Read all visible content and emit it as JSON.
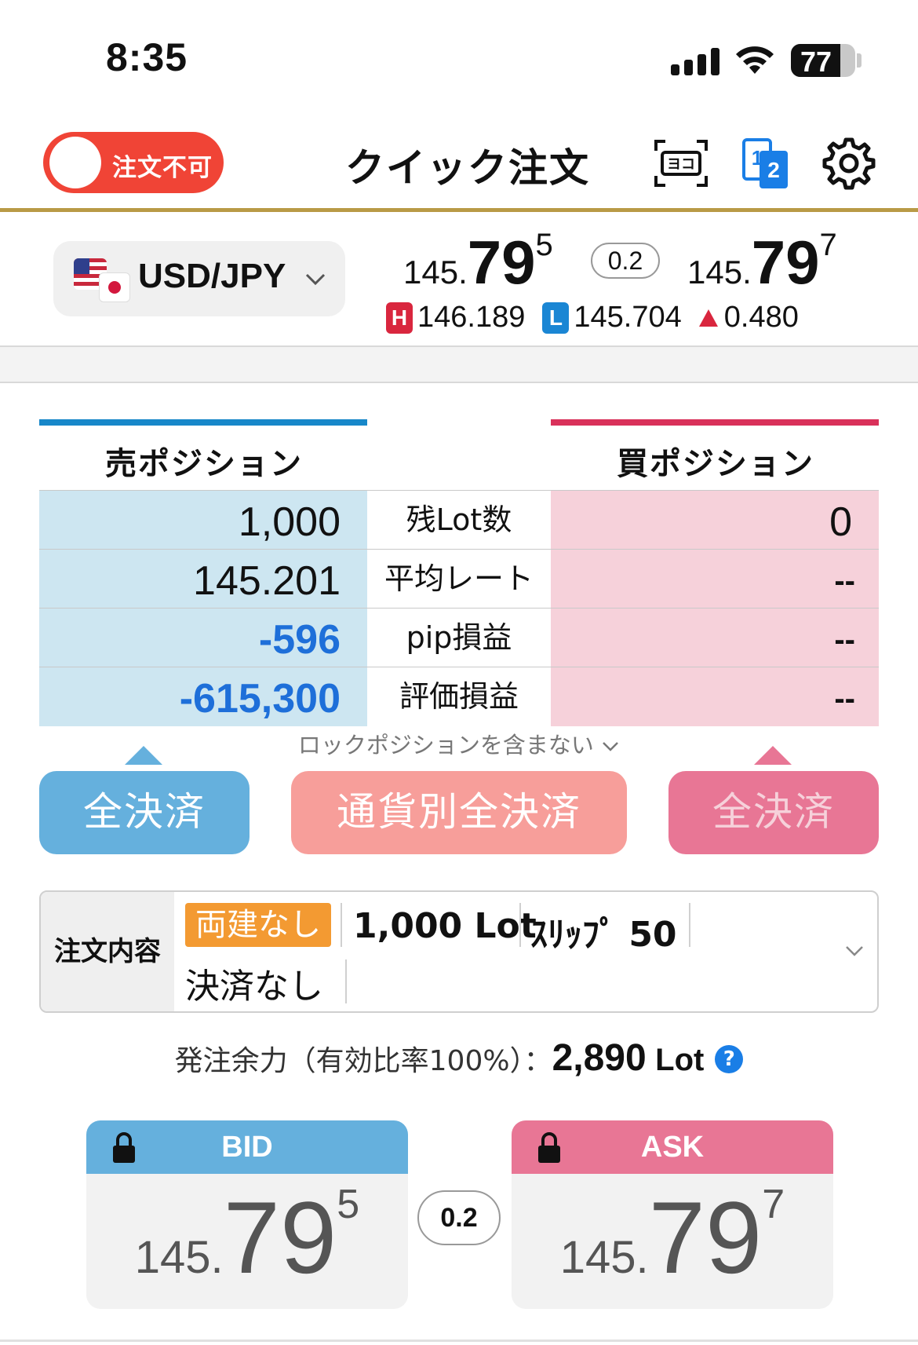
{
  "status_bar": {
    "time": "8:35",
    "battery": "77",
    "battery_level": 0.77
  },
  "header": {
    "toggle_label": "注文不可",
    "title": "クイック注文",
    "icons": [
      "display-mode-icon",
      "split-view-icon",
      "gear-icon"
    ]
  },
  "pair": {
    "name": "USD/JPY",
    "bid": {
      "prefix": "145.",
      "big": "79",
      "pip": "5"
    },
    "spread": "0.2",
    "ask": {
      "prefix": "145.",
      "big": "79",
      "pip": "7"
    },
    "high_badge": "H",
    "high": "146.189",
    "low_badge": "L",
    "low": "145.704",
    "change": "0.480"
  },
  "positions": {
    "sell_title": "売ポジション",
    "buy_title": "買ポジション",
    "rows": [
      {
        "label": "残Lot数",
        "sell": "1,000",
        "buy": "0"
      },
      {
        "label": "平均レート",
        "sell": "145.201",
        "buy": "--"
      },
      {
        "label": "pip損益",
        "sell": "-596",
        "buy": "--"
      },
      {
        "label": "評価損益",
        "sell": "-615,300",
        "buy": "--"
      }
    ],
    "lock_note": "ロックポジションを含まない"
  },
  "buttons": {
    "sell_close_all": "全決済",
    "currency_close_all": "通貨別全決済",
    "buy_close_all": "全決済"
  },
  "order": {
    "label": "注文内容",
    "tag": "両建なし",
    "lot": "1,000 Lot",
    "slip": "ｽﾘｯﾌﾟ 50",
    "settlement": "決済なし"
  },
  "capacity": {
    "label": "発注余力（有効比率100%）：",
    "value": "2,890",
    "unit": "Lot",
    "help": "?"
  },
  "quotes": {
    "bid_label": "BID",
    "ask_label": "ASK",
    "spread": "0.2",
    "bid": {
      "prefix": "145.",
      "big": "79",
      "pip": "5"
    },
    "ask": {
      "prefix": "145.",
      "big": "79",
      "pip": "7"
    }
  },
  "colors": {
    "sell_blue": "#1787c9",
    "buy_red": "#d9315a",
    "toggle_red": "#f04436",
    "gold_line": "#b99a46",
    "bid_head": "#65b0dd",
    "ask_head": "#e87695"
  }
}
